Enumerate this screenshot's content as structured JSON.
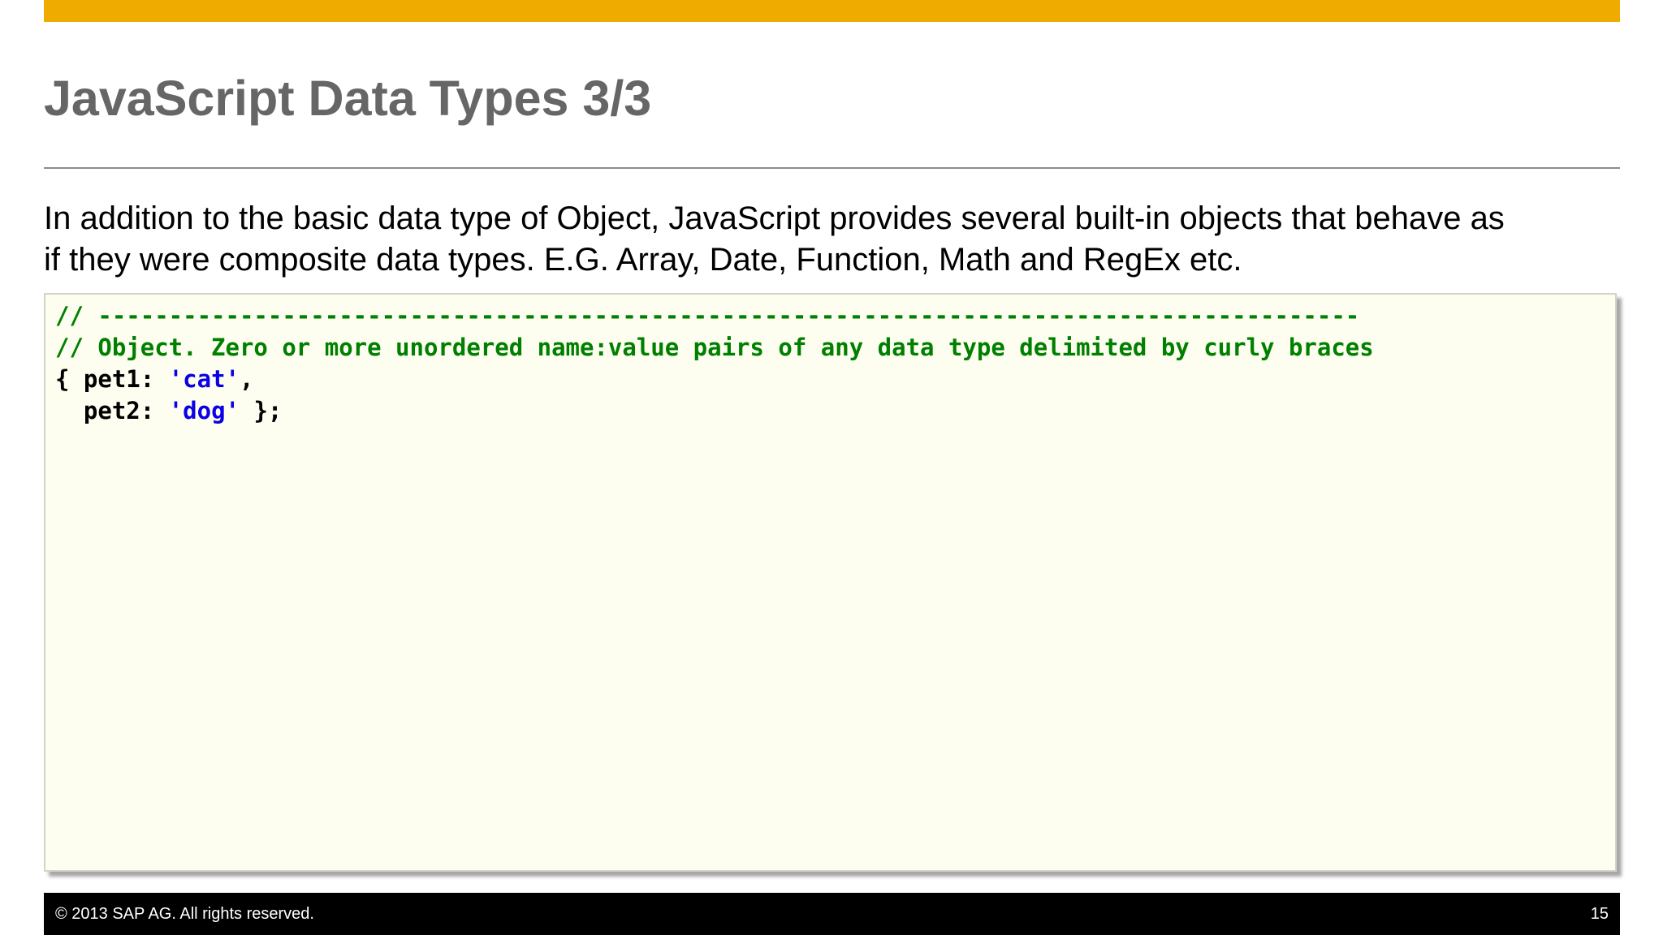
{
  "slide": {
    "title": "JavaScript Data Types 3/3",
    "intro_lines": [
      "In addition to the basic data type of Object, JavaScript provides several built-in objects that behave as",
      "if they were composite data types.  E.G. Array, Date, Function, Math and RegEx etc."
    ]
  },
  "code": {
    "line1_comment": "// -----------------------------------------------------------------------------------------",
    "line2_comment": "// Object. Zero or more unordered name:value pairs of any data type delimited by curly braces",
    "line3_prefix": "{ pet1: ",
    "line3_string": "'cat'",
    "line3_suffix": ",",
    "line4_prefix": "  pet2: ",
    "line4_string": "'dog'",
    "line4_suffix": " };"
  },
  "footer": {
    "copyright": "©  2013 SAP AG. All rights reserved.",
    "page_number": "15"
  },
  "colors": {
    "accent_bar": "#f0ab00",
    "title": "#666666",
    "code_background": "#fefef0",
    "code_comment": "#008000",
    "code_string": "#0a00e6",
    "footer_background": "#000000"
  }
}
